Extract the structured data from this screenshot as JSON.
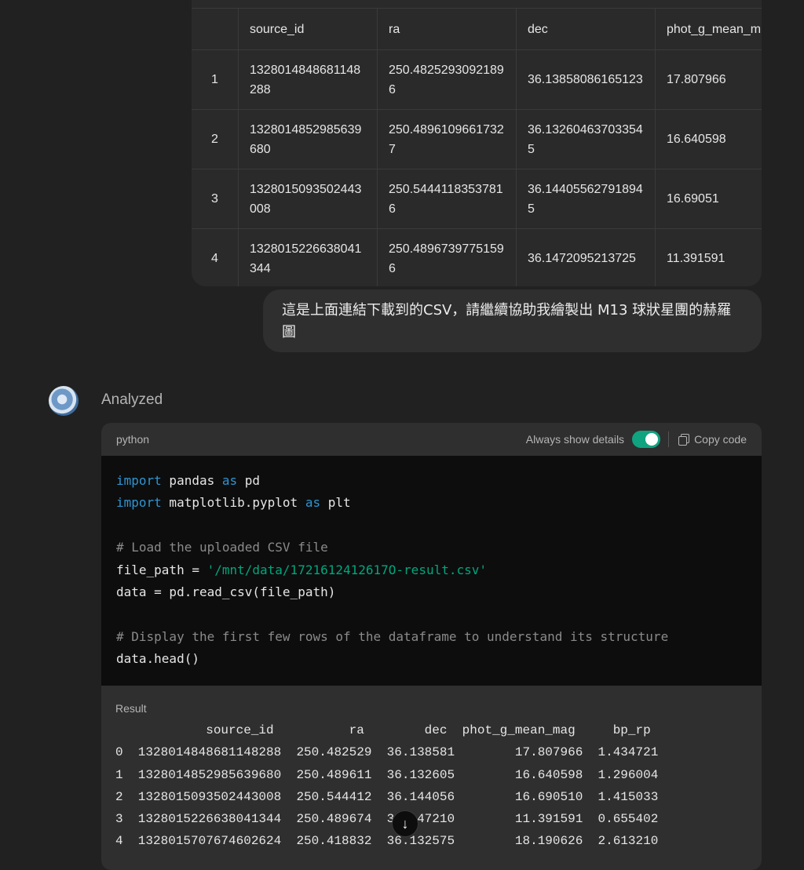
{
  "table": {
    "headers": [
      "",
      "source_id",
      "ra",
      "dec",
      "phot_g_mean_m"
    ],
    "rows": [
      [
        "1",
        "1328014848681148288",
        "250.48252930921896",
        "36.13858086165123",
        "17.807966"
      ],
      [
        "2",
        "1328014852985639680",
        "250.48961096617327",
        "36.13260463703354​5",
        "16.640598"
      ],
      [
        "3",
        "1328015093502443008",
        "250.54441183537816",
        "36.14405562791894​5",
        "16.69051"
      ],
      [
        "4",
        "1328015226638041344",
        "250.48967397751596",
        "36.1472095213725",
        "11.391591"
      ]
    ]
  },
  "user_message": "這是上面連結下載到的CSV，請繼續協助我繪製出 M13 球狀星團的赫羅圖",
  "assistant": {
    "status": "Analyzed",
    "avatar_icon": "chatgpt-avatar-icon"
  },
  "code_block": {
    "language": "python",
    "toggle_label": "Always show details",
    "toggle_on": true,
    "copy_label": "Copy code",
    "lines": {
      "l1_kw": "import",
      "l1_rest": " pandas ",
      "l1_kw2": "as",
      "l1_end": " pd",
      "l2_kw": "import",
      "l2_rest": " matplotlib.pyplot ",
      "l2_kw2": "as",
      "l2_end": " plt",
      "l3_comment": "# Load the uploaded CSV file",
      "l4_start": "file_path = ",
      "l4_str": "'/mnt/data/1721612412617O-result.csv'",
      "l5": "data = pd.read_csv(file_path)",
      "l6_comment": "# Display the first few rows of the dataframe to understand its structure",
      "l7": "data.head()"
    }
  },
  "result": {
    "label": "Result",
    "header": "            source_id          ra        dec  phot_g_mean_mag     bp_rp",
    "rows": [
      "0  1328014848681148288  250.482529  36.138581        17.807966  1.434721",
      "1  1328014852985639680  250.489611  36.132605        16.640598  1.296004",
      "2  1328015093502443008  250.544412  36.144056        16.690510  1.415033",
      "3  1328015226638041344  250.489674  36.147210        11.391591  0.655402",
      "4  1328015707674602624  250.418832  36.132575        18.190626  2.613210"
    ]
  },
  "colors": {
    "background": "#212121",
    "keyword": "#2e95d3",
    "string": "#00a67d",
    "toggle": "#10a37f"
  }
}
